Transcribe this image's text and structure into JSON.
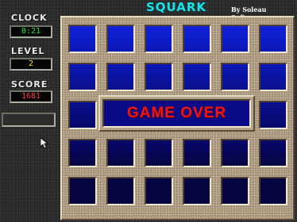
{
  "app": {
    "title": "SQUARK",
    "byline": "By Soleau Software"
  },
  "sidebar": {
    "clock": {
      "label": "CLOCK",
      "value": "0:21"
    },
    "level": {
      "label": "LEVEL",
      "value": "2"
    },
    "score": {
      "label": "SCORE",
      "value": "1681"
    }
  },
  "board": {
    "rows": 5,
    "cols": 6,
    "overlay_text": "GAME OVER",
    "tile_colors": [
      "#0e22d8",
      "#0b18b8",
      "#0a0f8c",
      "#07086a",
      "#050542"
    ]
  },
  "colors": {
    "title": "#19e3ea",
    "clock_digits": "#23e64a",
    "level_digits": "#f5e31c",
    "score_digits": "#ff3a3a",
    "game_over": "#f01414"
  }
}
